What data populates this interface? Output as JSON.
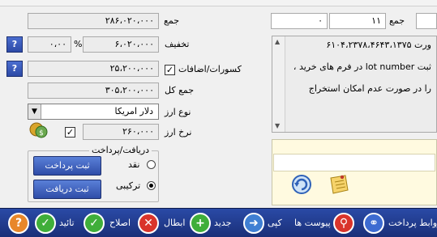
{
  "top_right": {
    "sum_label": "جمع",
    "count_value": "۱۱",
    "amount_value": "۰",
    "sum_label_mid": "جمع"
  },
  "fields": {
    "total": "۲۸۶،۰۲۰،۰۰۰",
    "discount": "۶،۰۲۰،۰۰۰",
    "discount_percent": "۰،۰۰",
    "percent_sign": "%",
    "deductions": "۲۵،۲۰۰،۰۰۰",
    "grand_total": "۳۰۵،۲۰۰،۰۰۰",
    "currency_type": "دلار امریکا",
    "exchange_rate": "۲۶۰،۰۰۰"
  },
  "labels": {
    "total": "جمع",
    "discount": "تخفیف",
    "deductions": "کسورات/اضافات",
    "grand_total": "جمع کل",
    "currency_type": "نوع ارز",
    "exchange_rate": "نرخ ارز",
    "help": "?"
  },
  "memo": {
    "lines": [
      "ورت  ۶۱۰۴،۲۳۷۸،۴۶۴۳،۱۳۷۵",
      "ثبت lot number در فرم های خرید ،",
      "را در صورت عدم امکان استخراج"
    ]
  },
  "payment_group": {
    "title": "دریافت/پرداخت",
    "cash_label": "نقد",
    "combined_label": "ترکیبی",
    "selected": "combined",
    "register_payment": "ثبت پرداخت",
    "register_receipt": "ثبت دریافت"
  },
  "toolbar": {
    "items": [
      {
        "label": "روابط پرداخت",
        "icon": "payment-relations-icon"
      },
      {
        "label": "پیوست ها",
        "icon": "attachment-icon"
      },
      {
        "label": "کپی",
        "icon": "copy-icon"
      },
      {
        "label": "جدید",
        "icon": "add-icon"
      },
      {
        "label": "ابطال",
        "icon": "cancel-icon"
      },
      {
        "label": "اصلاح",
        "icon": "check-icon"
      },
      {
        "label": "تائید",
        "icon": "approve-icon"
      },
      {
        "label": "",
        "icon": "help-icon"
      }
    ]
  },
  "colors": {
    "toolbar": "#1f3a8f",
    "accent_button": "#3a5cc0",
    "memo_panel": "#fffae0"
  }
}
